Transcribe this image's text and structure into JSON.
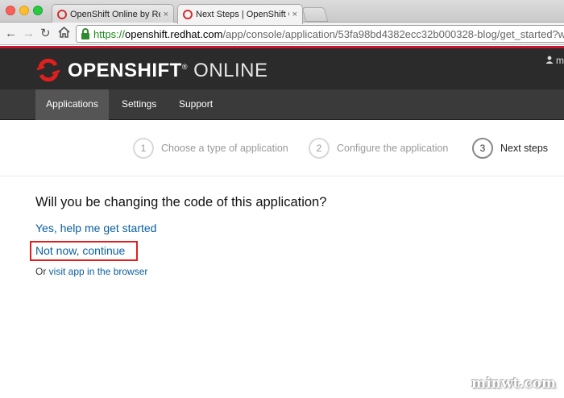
{
  "browser": {
    "tabs": [
      {
        "title": "OpenShift Online by Red H",
        "active": false
      },
      {
        "title": "Next Steps | OpenShift Onl",
        "active": true
      }
    ],
    "tab_close": "×",
    "url": {
      "scheme": "https://",
      "host": "openshift.redhat.com",
      "path": "/app/console/application/53fa98bd4382ecc32b000328-blog/get_started?w"
    }
  },
  "header": {
    "brand_bold": "OPENSHIFT",
    "brand_tm": "®",
    "brand_light": " ONLINE",
    "user_initial": "m",
    "accent_color": "#c8162e"
  },
  "nav": {
    "items": [
      {
        "label": "Applications",
        "active": true
      },
      {
        "label": "Settings",
        "active": false
      },
      {
        "label": "Support",
        "active": false
      }
    ]
  },
  "steps": [
    {
      "num": "1",
      "label": "Choose a type of application",
      "current": false
    },
    {
      "num": "2",
      "label": "Configure the application",
      "current": false
    },
    {
      "num": "3",
      "label": "Next steps",
      "current": true
    }
  ],
  "content": {
    "question": "Will you be changing the code of this application?",
    "yes_link": "Yes, help me get started",
    "not_now_link": "Not now, continue",
    "or_prefix": "Or ",
    "visit_link": "visit app in the browser"
  },
  "watermark": "minwt.com",
  "icons": {
    "back": "back-arrow-icon",
    "forward": "forward-arrow-icon",
    "reload": "reload-icon",
    "home": "home-icon",
    "lock": "lock-icon",
    "user": "user-icon",
    "logo": "openshift-logo-icon"
  }
}
